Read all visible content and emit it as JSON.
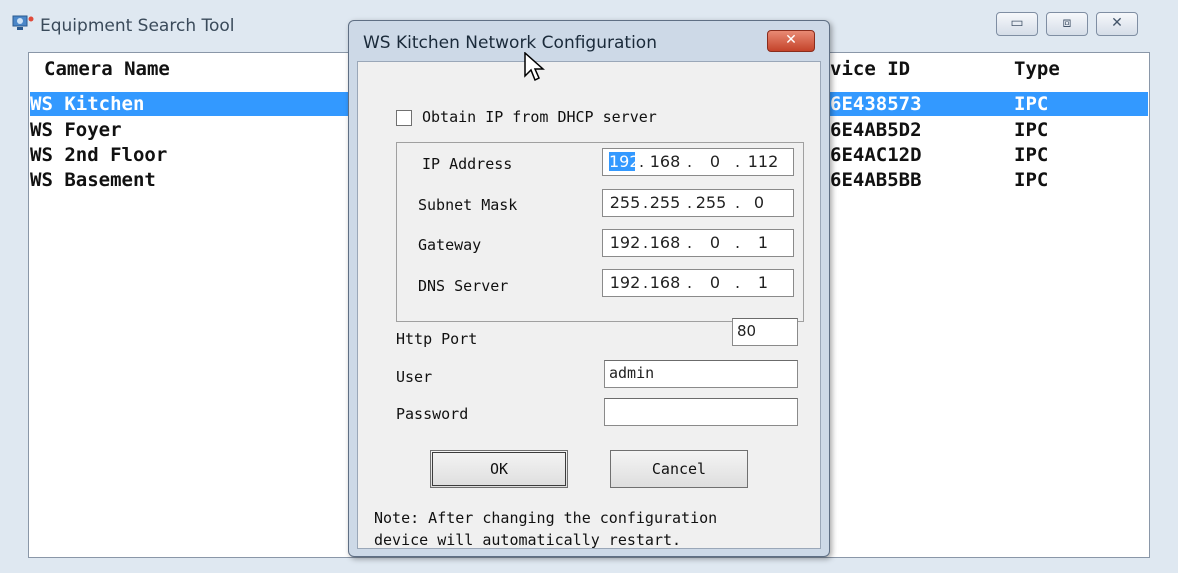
{
  "main": {
    "title": "Equipment Search Tool",
    "columns": {
      "name": "Camera Name",
      "device_id": "vice ID",
      "type": "Type"
    },
    "rows": [
      {
        "name": "WS Kitchen",
        "device_id": "6E438573",
        "type": "IPC",
        "selected": true
      },
      {
        "name": "WS Foyer",
        "device_id": "6E4AB5D2",
        "type": "IPC"
      },
      {
        "name": "WS 2nd Floor",
        "device_id": "6E4AC12D",
        "type": "IPC"
      },
      {
        "name": "WS Basement",
        "device_id": "6E4AB5BB",
        "type": "IPC"
      }
    ],
    "controls": {
      "minimize": "▭",
      "maximize": "⧈",
      "close": "✕"
    }
  },
  "dialog": {
    "title": "WS Kitchen Network Configuration",
    "close_label": "✕",
    "dhcp_label": "Obtain IP from DHCP server",
    "dhcp_checked": false,
    "ip_label": "IP Address",
    "ip": [
      "192",
      "168",
      "0",
      "112"
    ],
    "subnet_label": "Subnet Mask",
    "subnet": [
      "255",
      "255",
      "255",
      "0"
    ],
    "gateway_label": "Gateway",
    "gateway": [
      "192",
      "168",
      "0",
      "1"
    ],
    "dns_label": "DNS Server",
    "dns": [
      "192",
      "168",
      "0",
      "1"
    ],
    "http_port_label": "Http Port",
    "http_port": "80",
    "user_label": "User",
    "user": "admin",
    "password_label": "Password",
    "password": "",
    "ok_label": "OK",
    "cancel_label": "Cancel",
    "note_line1": "Note: After changing the configuration",
    "note_line2": "device will automatically restart."
  },
  "colors": {
    "selection": "#3399ff",
    "dialog_frame": "#cdd9e7",
    "close_button": "#c4432a"
  }
}
